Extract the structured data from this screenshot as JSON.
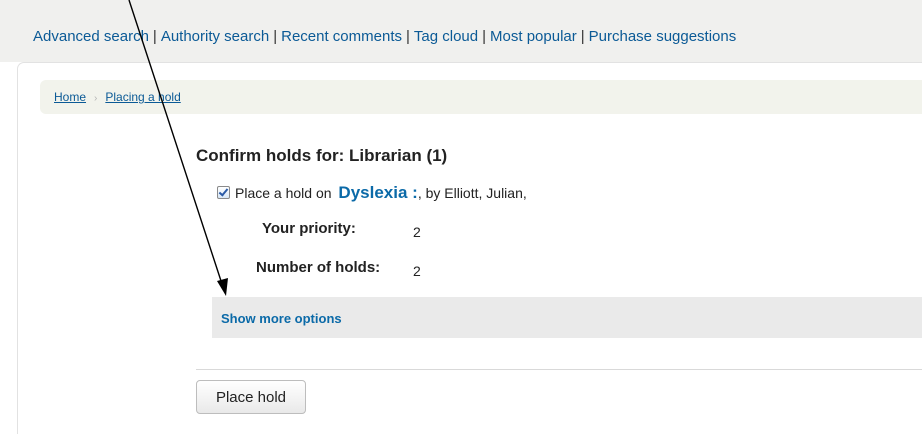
{
  "top_nav": {
    "links": [
      "Advanced search",
      "Authority search",
      "Recent comments",
      "Tag cloud",
      "Most popular",
      "Purchase suggestions"
    ],
    "separator": "|"
  },
  "breadcrumb": {
    "home": "Home",
    "separator": "›",
    "current": "Placing a hold"
  },
  "confirm": {
    "title": "Confirm holds for: Librarian (1)"
  },
  "hold": {
    "checked": true,
    "prefix": "Place a hold on",
    "item_title": "Dyslexia :",
    "byline": ", by Elliott, Julian,"
  },
  "fields": {
    "priority_label": "Your priority:",
    "priority_value": "2",
    "holds_label": "Number of holds:",
    "holds_value": "2"
  },
  "more_options": {
    "label": "Show more options"
  },
  "actions": {
    "place_hold_label": "Place hold"
  },
  "colors": {
    "link": "#0b5a96",
    "title_link": "#0b6aa8",
    "bar_bg": "#eaeaea"
  }
}
